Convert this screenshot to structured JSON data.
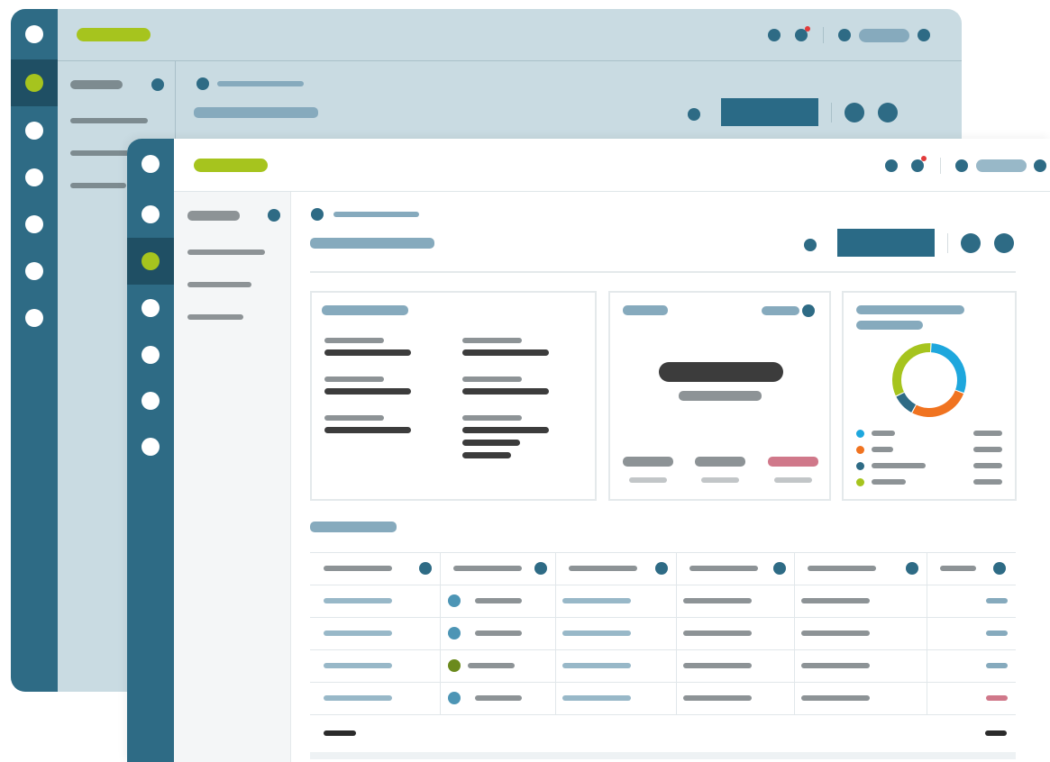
{
  "colors": {
    "rail": "#2e6b85",
    "rail_active": "#1f4f64",
    "accent_green": "#a6c41e",
    "primary_button": "#2a6a86",
    "placeholder_blue": "#86aabd",
    "placeholder_gray": "#8d9396",
    "placeholder_dark": "#3c3c3c",
    "donut_blue": "#1ea7dd",
    "donut_orange": "#f07320",
    "donut_navy": "#2e6b85",
    "donut_green": "#a6c41e",
    "badge_pink": "#d0788a"
  },
  "back_window": {
    "rail_icons": [
      "home-icon",
      "dashboard-icon",
      "reports-icon",
      "users-icon",
      "settings-icon",
      "billing-icon",
      "help-icon"
    ],
    "active_index": 1
  },
  "front_window": {
    "rail_icons": [
      "home-icon",
      "overview-icon",
      "dashboard-icon",
      "reports-icon",
      "users-icon",
      "settings-icon",
      "help-icon"
    ],
    "active_index": 2
  },
  "donut": {
    "segments": [
      {
        "color": "#1ea7dd",
        "fraction": 0.3
      },
      {
        "color": "#f07320",
        "fraction": 0.27
      },
      {
        "color": "#2e6b85",
        "fraction": 0.1
      },
      {
        "color": "#a6c41e",
        "fraction": 0.33
      }
    ]
  },
  "table": {
    "row_status_colors": [
      "#4d95b5",
      "#4d95b5",
      "#6b8a1d",
      "#4d95b5"
    ],
    "last_col_colors": [
      "#86aabd",
      "#86aabd",
      "#86aabd",
      "#d0788a"
    ]
  }
}
